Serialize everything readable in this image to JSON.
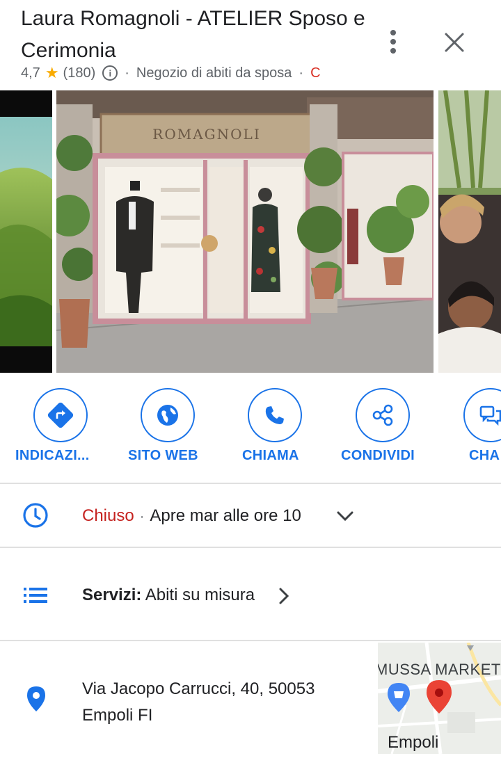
{
  "place": {
    "title": "Laura Romagnoli - ATELIER Sposo e Cerimonia",
    "rating": "4,7",
    "reviews": "(180)",
    "category": "Negozio di abiti da sposa",
    "status_short": "C"
  },
  "photos": {
    "storefront_sign": "ROMAGNOLI"
  },
  "actions": [
    {
      "label": "INDICAZI...",
      "icon": "directions-icon"
    },
    {
      "label": "SITO WEB",
      "icon": "globe-icon"
    },
    {
      "label": "CHIAMA",
      "icon": "phone-icon"
    },
    {
      "label": "CONDIVIDI",
      "icon": "share-icon"
    },
    {
      "label": "CHA",
      "icon": "chat-icon"
    }
  ],
  "hours": {
    "status": "Chiuso",
    "separator": "·",
    "next_open": "Apre mar alle ore 10"
  },
  "services": {
    "label": "Servizi:",
    "value": "Abiti su misura"
  },
  "address": {
    "line1": "Via Jacopo Carrucci, 40, 50053",
    "line2": "Empoli FI"
  },
  "map": {
    "label_top": "MUSSA MARKET",
    "label_bottom": "Empoli"
  },
  "colors": {
    "accent": "#1a73e8",
    "closed": "#c5221f",
    "star": "#f9ab00",
    "pin": "#ea4335"
  }
}
